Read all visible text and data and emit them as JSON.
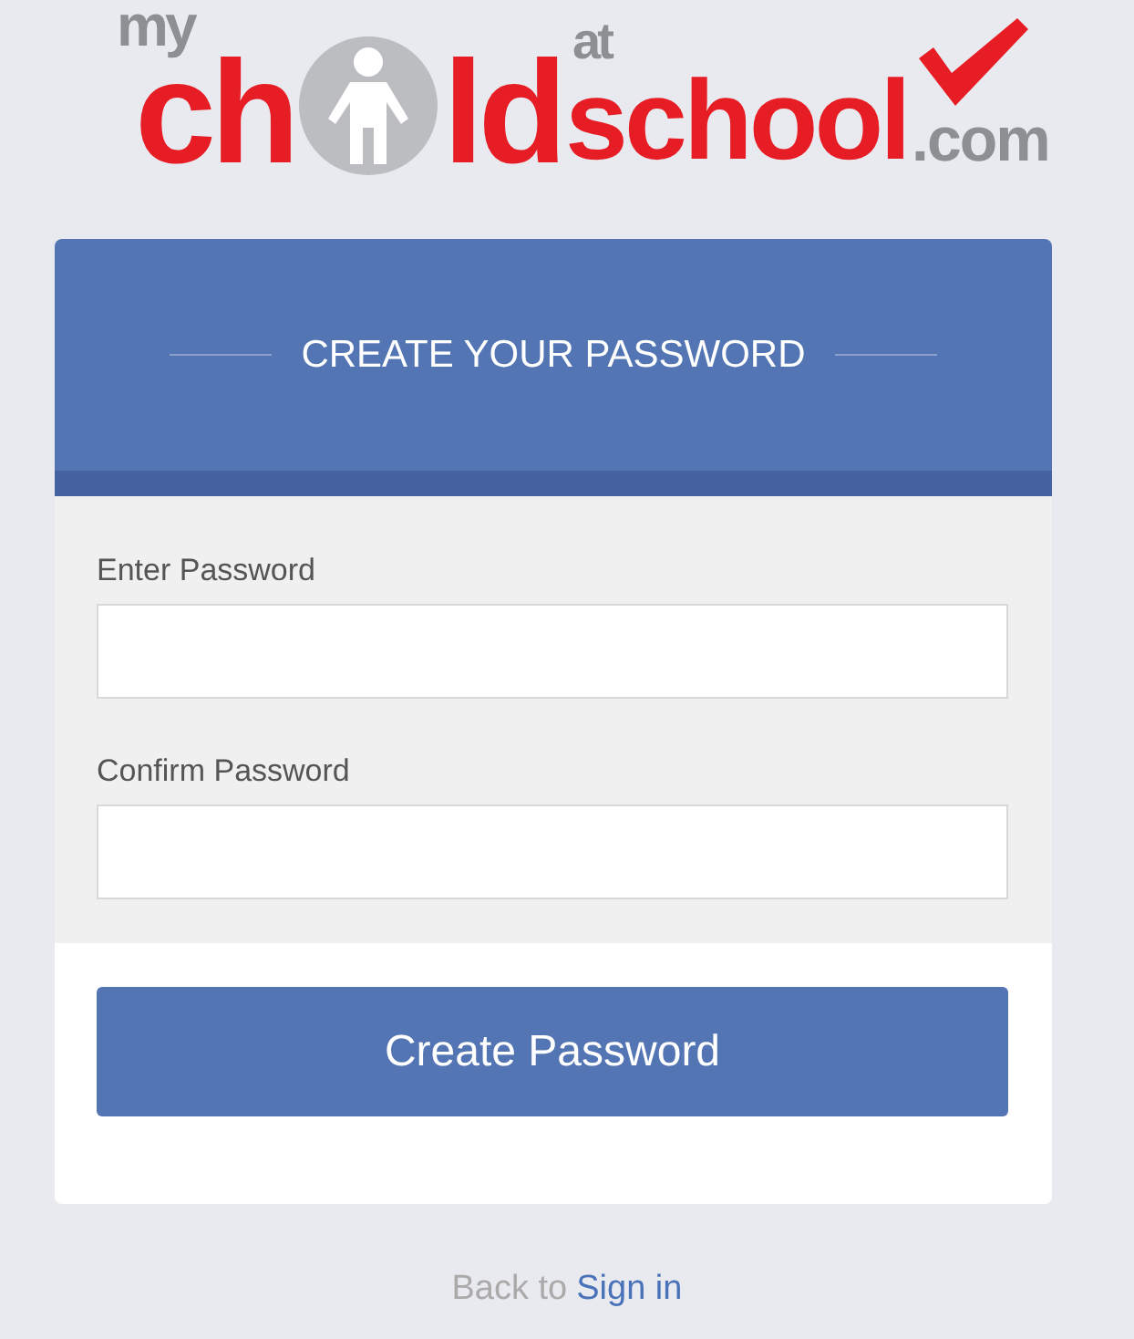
{
  "logo": {
    "word_1": "my",
    "word_2a": "ch",
    "word_2b": "ld",
    "word_3": "at",
    "word_4": "school",
    "word_5": ".com"
  },
  "card": {
    "title": "CREATE YOUR PASSWORD",
    "fields": [
      {
        "label": "Enter Password"
      },
      {
        "label": "Confirm Password"
      }
    ],
    "button": "Create Password"
  },
  "footer": {
    "text": "Back to",
    "link": "Sign in"
  }
}
